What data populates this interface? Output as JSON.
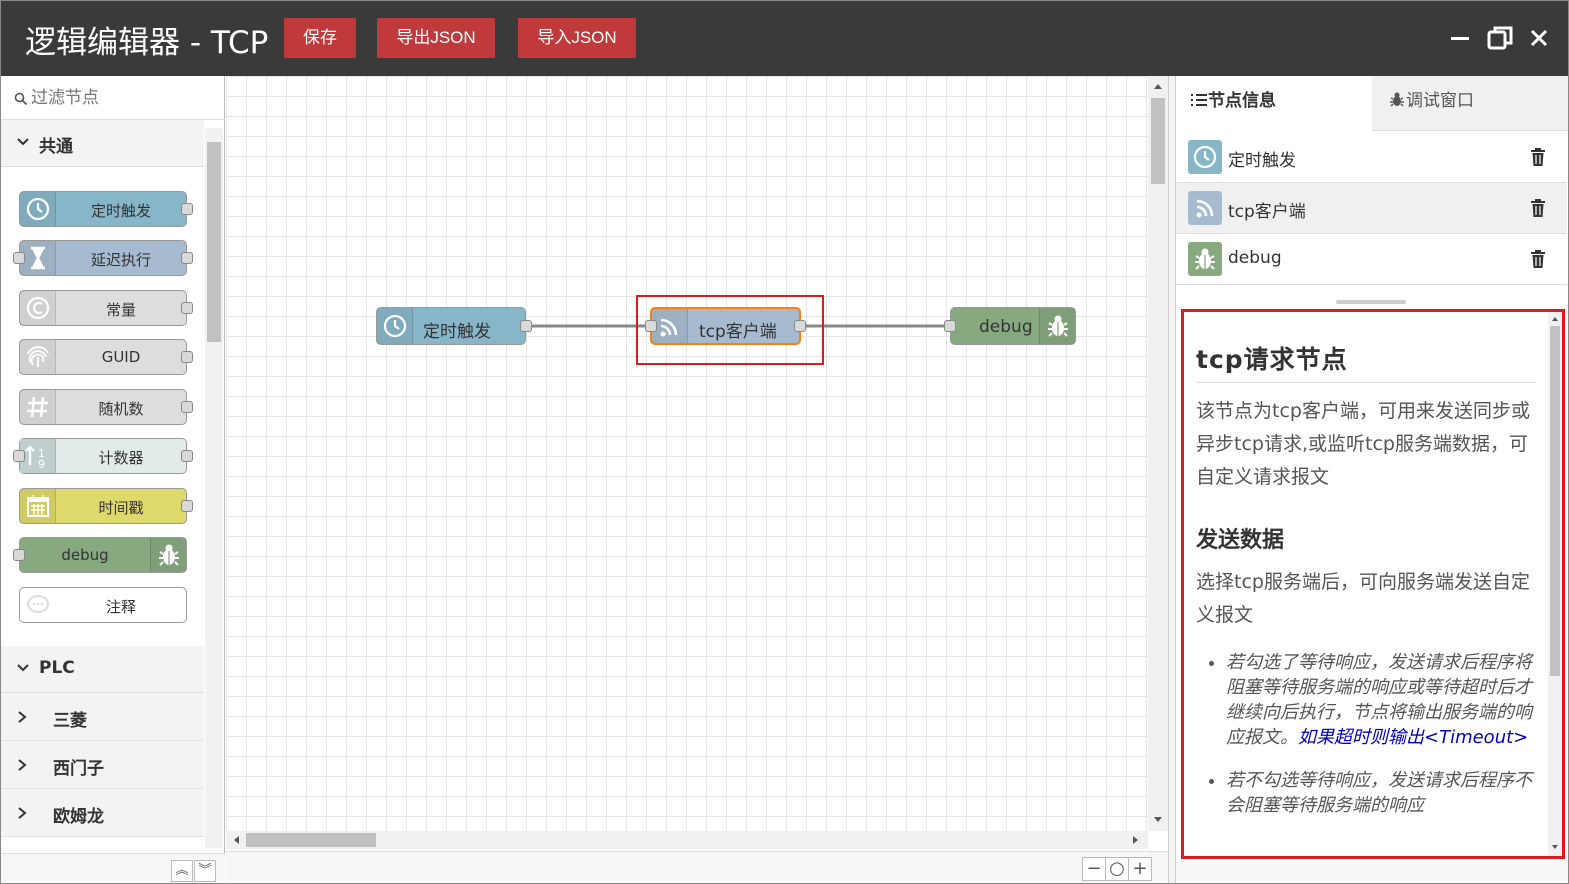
{
  "window": {
    "title": "逻辑编辑器 - TCP"
  },
  "toolbar": {
    "save": "保存",
    "export": "导出JSON",
    "import": "导入JSON"
  },
  "palette": {
    "filter_placeholder": "过滤节点",
    "category_common": "共通",
    "nodes": [
      "定时触发",
      "延迟执行",
      "常量",
      "GUID",
      "随机数",
      "计数器",
      "时间戳",
      "debug",
      "注释"
    ],
    "category_plc": "PLC",
    "plc_items": [
      "三菱",
      "西门子",
      "欧姆龙"
    ]
  },
  "flow": {
    "nodes": [
      "定时触发",
      "tcp客户端",
      "debug"
    ]
  },
  "sidebar": {
    "tab_info": "节点信息",
    "tab_debug": "调试窗口",
    "node_list": [
      "定时触发",
      "tcp客户端",
      "debug"
    ],
    "help": {
      "title": "tcp请求节点",
      "intro": "该节点为tcp客户端，可用来发送同步或异步tcp请求,或监听tcp服务端数据，可自定义请求报文",
      "send_heading": "发送数据",
      "send_desc": "选择tcp服务端后，可向服务端发送自定义报文",
      "bullet1": "若勾选了等待响应，发送请求后程序将阻塞等待服务端的响应或等待超时后才继续向后执行，节点将输出服务端的响应报文。",
      "bullet1_link": "如果超时则输出<Timeout>",
      "bullet2": "若不勾选等待响应，发送请求后程序不会阻塞等待服务端的响应"
    }
  },
  "colors": {
    "titlebar": "#3a3a3a",
    "button": "#c0393b",
    "trigger": "#87b6c8",
    "tcp": "#a6bbcf",
    "debug": "#87a980",
    "timestamp": "#dfd86a",
    "highlight": "#e0191c"
  }
}
